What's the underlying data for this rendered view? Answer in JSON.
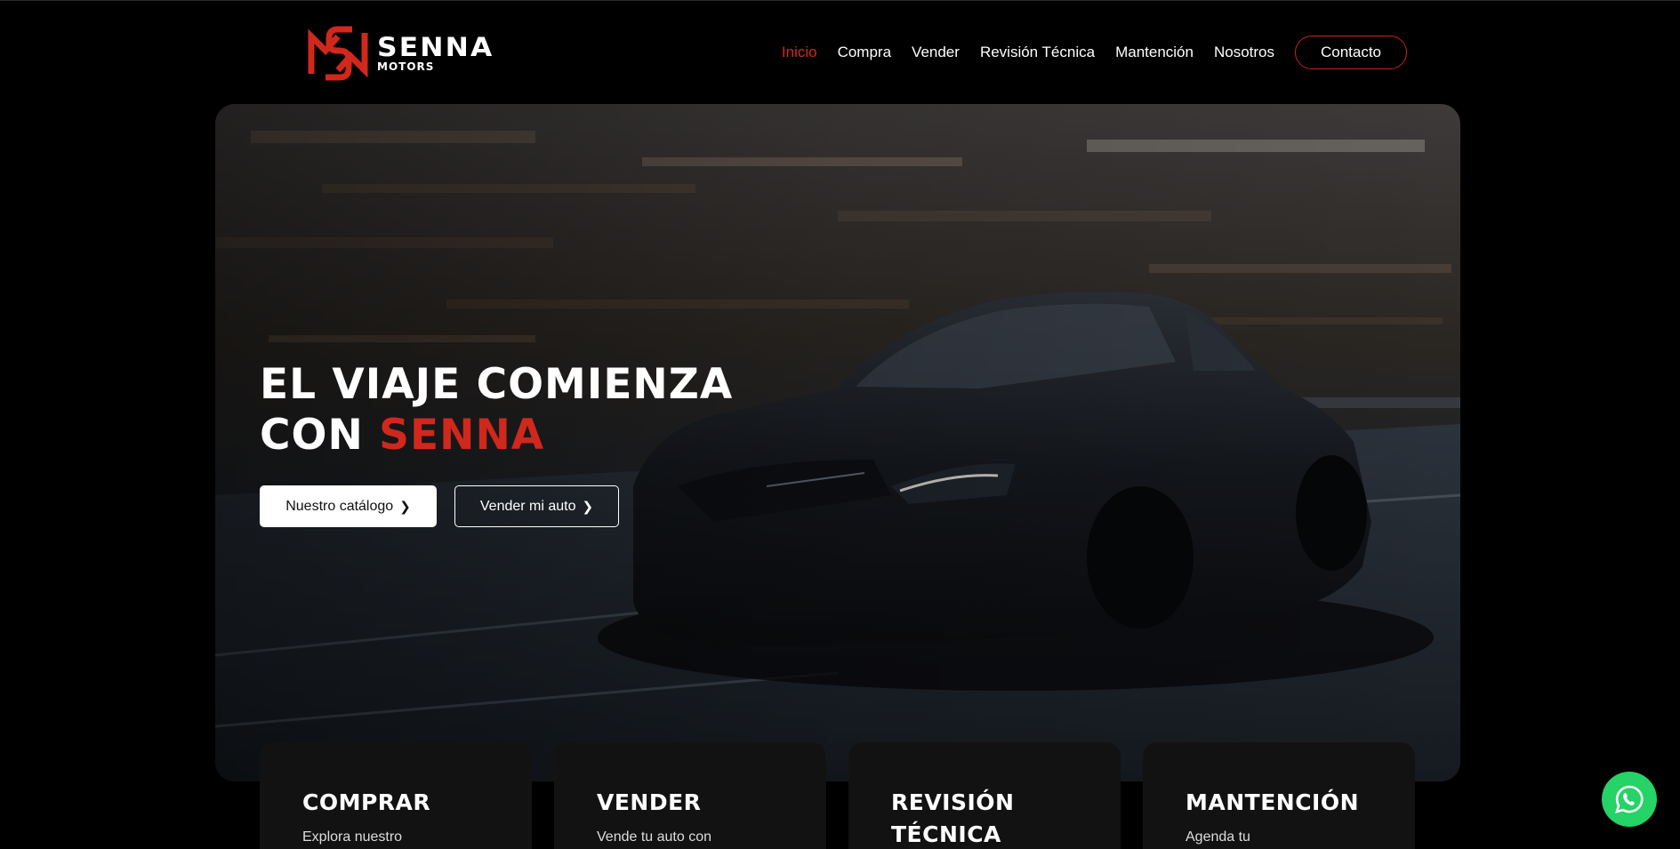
{
  "brand": {
    "name": "SENNA",
    "subtitle": "MOTORS",
    "accent_color": "#d0281d"
  },
  "nav": {
    "items": [
      {
        "label": "Inicio",
        "active": true
      },
      {
        "label": "Compra"
      },
      {
        "label": "Vender"
      },
      {
        "label": "Revisión Técnica"
      },
      {
        "label": "Mantención"
      },
      {
        "label": "Nosotros"
      }
    ],
    "contact_label": "Contacto"
  },
  "hero": {
    "headline_line1": "EL VIAJE COMIENZA",
    "headline_line2_prefix": "CON ",
    "headline_line2_accent": "SENNA",
    "primary_button": "Nuestro catálogo",
    "secondary_button": "Vender mi auto",
    "button_icon": "chevron-right-icon",
    "background_image": "black coupe driving on a forest road"
  },
  "cards": [
    {
      "title": "COMPRAR",
      "text": "Explora nuestro"
    },
    {
      "title": "VENDER",
      "text": "Vende tu auto con"
    },
    {
      "title": "REVISIÓN TÉCNICA",
      "text": ""
    },
    {
      "title": "MANTENCIÓN",
      "text": "Agenda tu"
    }
  ],
  "floating": {
    "icon": "whatsapp-icon",
    "color": "#25d366"
  }
}
